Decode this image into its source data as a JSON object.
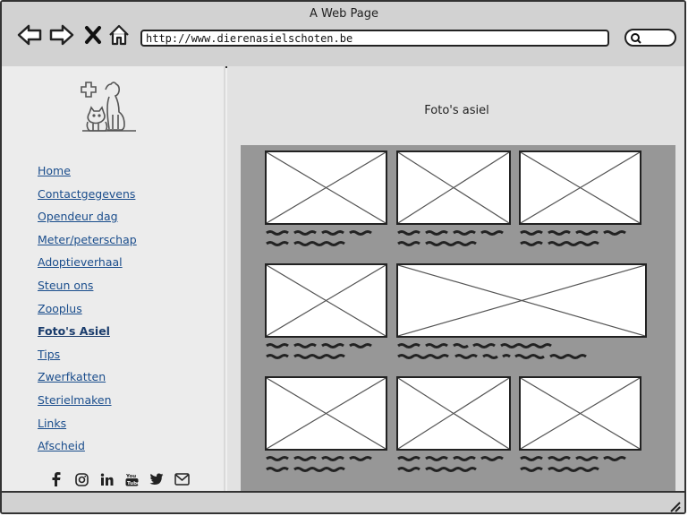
{
  "window": {
    "title": "A Web Page",
    "url": "http://www.dierenasielschoten.be"
  },
  "toolbar": {
    "icons": [
      "back-arrow-icon",
      "forward-arrow-icon",
      "close-x-icon",
      "home-icon",
      "search-icon"
    ]
  },
  "sidebar": {
    "logo_icon": "animal-shelter-logo",
    "items": [
      {
        "label": "Home"
      },
      {
        "label": "Contactgegevens"
      },
      {
        "label": "Opendeur dag"
      },
      {
        "label": "Meter/peterschap"
      },
      {
        "label": "Adoptieverhaal"
      },
      {
        "label": "Steun ons"
      },
      {
        "label": "Zooplus"
      },
      {
        "label": "Foto's Asiel",
        "active": true
      },
      {
        "label": "Tips"
      },
      {
        "label": "Zwerfkatten"
      },
      {
        "label": "Sterielmaken"
      },
      {
        "label": "Links"
      },
      {
        "label": "Afscheid"
      }
    ],
    "social_icons": [
      "facebook-icon",
      "instagram-icon",
      "linkedin-icon",
      "youtube-icon",
      "twitter-icon",
      "mail-icon"
    ]
  },
  "main": {
    "title": "Foto's asiel"
  },
  "colors": {
    "link": "#1a4d8c",
    "gallery_bg": "#979797",
    "chrome": "#d2d2d2"
  }
}
